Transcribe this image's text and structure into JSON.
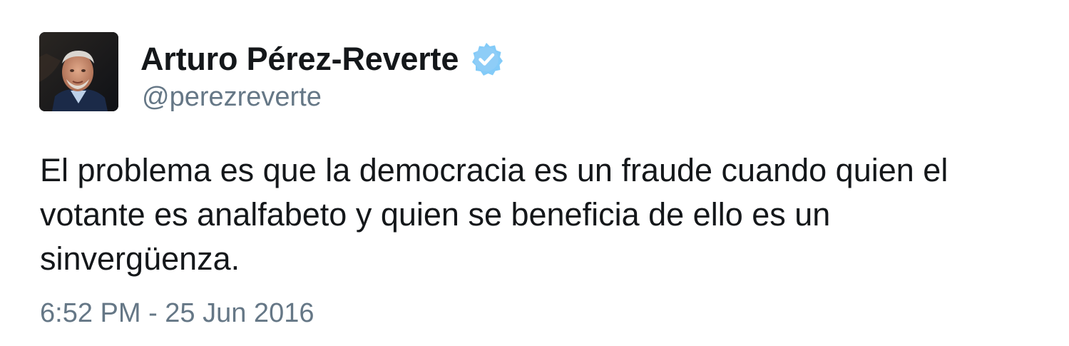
{
  "tweet": {
    "author": {
      "display_name": "Arturo Pérez-Reverte",
      "handle": "@perezreverte",
      "verified": true,
      "avatar_icon": "profile-photo"
    },
    "text_lines": [
      "El problema es que la democracia es un fraude cuando quien el",
      "votante es analfabeto y quien se beneficia de ello es un",
      "sinvergüenza."
    ],
    "timestamp": "6:52 PM - 25 Jun 2016"
  },
  "colors": {
    "text": "#14171a",
    "secondary": "#657786",
    "verified_badge": "#1da1f2"
  }
}
